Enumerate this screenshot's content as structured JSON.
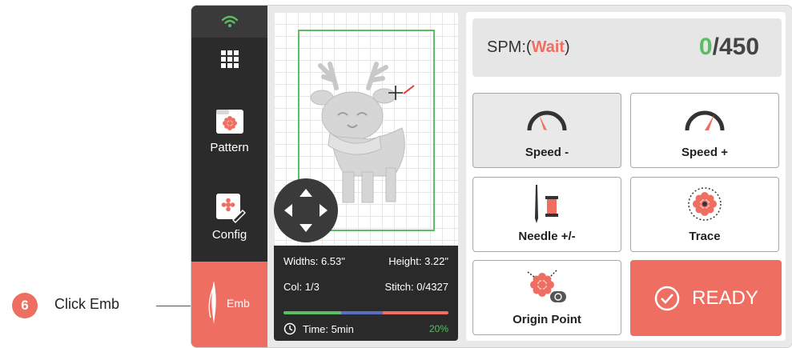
{
  "annotation": {
    "step_number": "6",
    "instruction": "Click Emb"
  },
  "sidebar": {
    "items": [
      {
        "label": "Pattern",
        "icon": "pattern-folder-icon"
      },
      {
        "label": "Config",
        "icon": "config-edit-icon"
      },
      {
        "label": "Emb",
        "icon": "needle-icon",
        "active": true
      }
    ],
    "wifi_icon": "wifi-icon",
    "apps_icon": "apps-grid-icon"
  },
  "info_panel": {
    "widths": "Widths: 6.53\"",
    "height": "Height: 3.22\"",
    "col": "Col: 1/3",
    "stitch": "Stitch: 0/4327",
    "time": "Time: 5min",
    "percent": "20%",
    "progress_segments": [
      0.35,
      0.25,
      0.4
    ]
  },
  "status": {
    "spm_prefix": "SPM:(",
    "spm_state": "Wait",
    "spm_suffix": ")",
    "stitch_done": "0",
    "stitch_total": "/450"
  },
  "buttons": {
    "speed_minus": "Speed -",
    "speed_plus": "Speed +",
    "needle": "Needle +/-",
    "trace": "Trace",
    "origin": "Origin Point",
    "ready": "READY"
  },
  "colors": {
    "accent": "#ef6e62",
    "green": "#5bbd64",
    "blue": "#5b6fc0",
    "dark": "#2b2b2b"
  }
}
